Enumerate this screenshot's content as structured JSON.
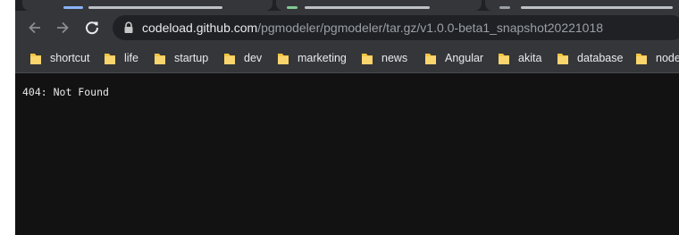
{
  "browser": {
    "url_host": "codeload.github.com",
    "url_path": "/pgmodeler/pgmodeler/tar.gz/v1.0.0-beta1_snapshot20221018"
  },
  "bookmarks": [
    {
      "label": "shortcut"
    },
    {
      "label": "life"
    },
    {
      "label": "startup"
    },
    {
      "label": "dev"
    },
    {
      "label": "marketing"
    },
    {
      "label": "news"
    },
    {
      "label": "Angular"
    },
    {
      "label": "akita"
    },
    {
      "label": "database"
    },
    {
      "label": "node"
    }
  ],
  "page": {
    "message": "404: Not Found"
  },
  "icons": {
    "back": "arrow-left-icon",
    "forward": "arrow-right-icon",
    "reload": "reload-icon",
    "lock": "lock-icon",
    "folder": "folder-icon"
  },
  "colors": {
    "folder": "#f4c542",
    "page_background": "#121212",
    "toolbar": "#35363a"
  }
}
